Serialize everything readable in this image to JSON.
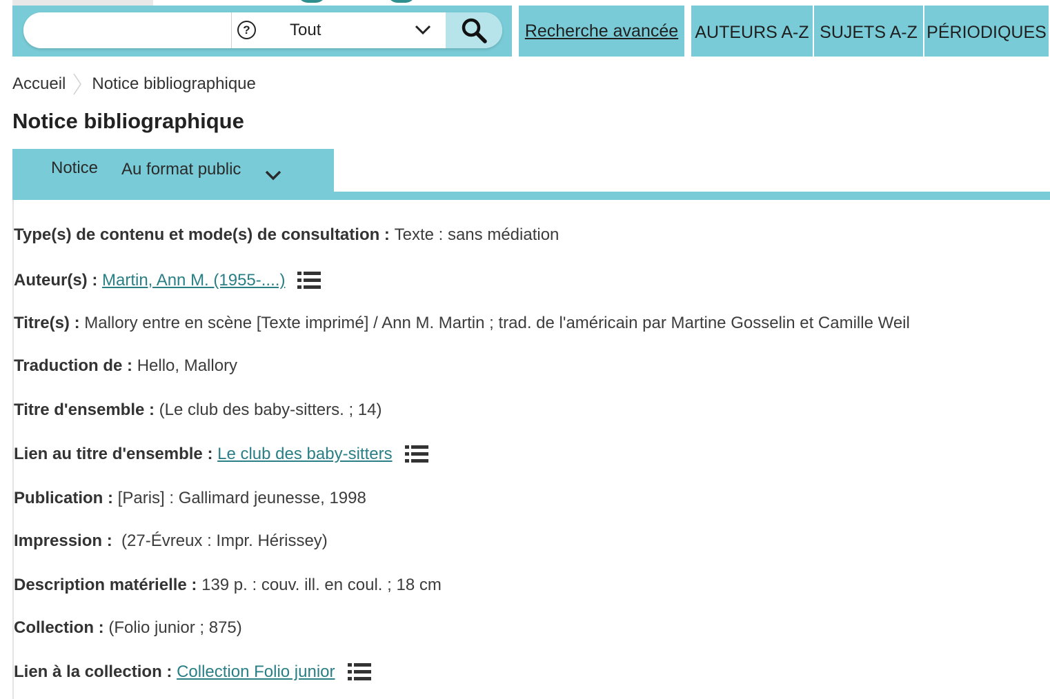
{
  "search": {
    "placeholder": "",
    "scope_value": "Tout",
    "help_symbol": "?"
  },
  "advanced_search": "Recherche avancée",
  "nav": {
    "authors": "AUTEURS A-Z",
    "subjects": "SUJETS A-Z",
    "periodicals": "PÉRIODIQUES"
  },
  "breadcrumb": {
    "home": "Accueil",
    "current": "Notice bibliographique"
  },
  "page_title": "Notice bibliographique",
  "tabs": {
    "notice": "Notice",
    "format": "Au format public"
  },
  "colors": {
    "accent": "#79ccd7",
    "link": "#2a7f86"
  },
  "fields": {
    "content_type": {
      "label": "Type(s) de contenu et mode(s) de consultation :",
      "value": "Texte : sans médiation"
    },
    "authors": {
      "label": "Auteur(s) :",
      "link": "Martin, Ann M. (1955-....)",
      "icon": "list-icon"
    },
    "titles": {
      "label": "Titre(s) :",
      "value": "Mallory entre en scène [Texte imprimé] / Ann M. Martin ; trad. de l'américain par Martine Gosselin et Camille Weil"
    },
    "translation": {
      "label": "Traduction de :",
      "value": "Hello, Mallory"
    },
    "series_title": {
      "label": "Titre d'ensemble :",
      "value": "(Le club des baby-sitters. ; 14)"
    },
    "series_link": {
      "label": "Lien au titre d'ensemble :",
      "link": "Le club des baby-sitters",
      "icon": "list-icon"
    },
    "publication": {
      "label": "Publication :",
      "value": "[Paris] : Gallimard jeunesse, 1998"
    },
    "printing": {
      "label": "Impression :",
      "value": "(27-Évreux : Impr. Hérissey)"
    },
    "physical": {
      "label": "Description matérielle :",
      "value": "139 p. : couv. ill. en coul. ; 18 cm"
    },
    "collection": {
      "label": "Collection :",
      "value": "(Folio junior ; 875)"
    },
    "collection_link": {
      "label": "Lien à la collection :",
      "link": "Collection Folio junior",
      "icon": "list-icon"
    }
  }
}
